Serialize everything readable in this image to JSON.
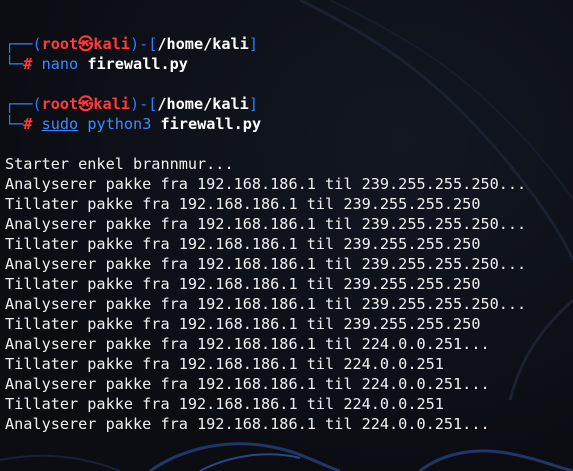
{
  "prompt": {
    "user": "root",
    "skull": "㉿",
    "host": "kali",
    "cwd": "/home/kali",
    "symbol": "#",
    "open_bracket": "(",
    "close_bracket": ")-[",
    "end_bracket": "]",
    "top_corner": "┌──",
    "bottom_corner": "└─"
  },
  "commands": [
    {
      "parts": [
        "nano",
        "firewall.py"
      ]
    },
    {
      "parts": [
        "sudo",
        "python3",
        "firewall.py"
      ]
    }
  ],
  "output": [
    "Starter enkel brannmur...",
    "Analyserer pakke fra 192.168.186.1 til 239.255.255.250...",
    "Tillater pakke fra 192.168.186.1 til 239.255.255.250",
    "Analyserer pakke fra 192.168.186.1 til 239.255.255.250...",
    "Tillater pakke fra 192.168.186.1 til 239.255.255.250",
    "Analyserer pakke fra 192.168.186.1 til 239.255.255.250...",
    "Tillater pakke fra 192.168.186.1 til 239.255.255.250",
    "Analyserer pakke fra 192.168.186.1 til 239.255.255.250...",
    "Tillater pakke fra 192.168.186.1 til 239.255.255.250",
    "Analyserer pakke fra 192.168.186.1 til 224.0.0.251...",
    "Tillater pakke fra 192.168.186.1 til 224.0.0.251",
    "Analyserer pakke fra 192.168.186.1 til 224.0.0.251...",
    "Tillater pakke fra 192.168.186.1 til 224.0.0.251",
    "Analyserer pakke fra 192.168.186.1 til 224.0.0.251..."
  ],
  "colors": {
    "background": "#0b0d13",
    "prompt_blue": "#2f7bff",
    "prompt_red": "#ff3b3b",
    "text": "#f0f0f0"
  }
}
